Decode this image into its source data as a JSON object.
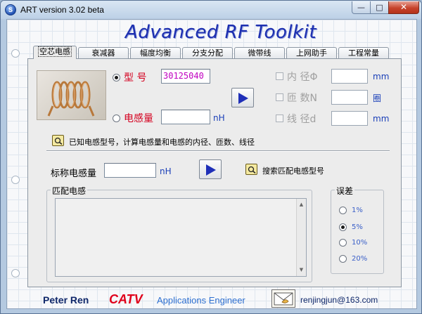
{
  "window": {
    "title": "ART version 3.02 beta",
    "app_icon_letter": "S",
    "minimize_glyph": "—",
    "maximize_glyph": "□",
    "close_glyph": "✕"
  },
  "banner": {
    "text": "Advanced RF Toolkit"
  },
  "tabs": [
    {
      "label": "空芯电感",
      "active": true
    },
    {
      "label": "衰减器",
      "active": false
    },
    {
      "label": "幅度均衡",
      "active": false
    },
    {
      "label": "分支分配",
      "active": false
    },
    {
      "label": "微带线",
      "active": false
    },
    {
      "label": "上网助手",
      "active": false
    },
    {
      "label": "工程常量",
      "active": false
    }
  ],
  "calc": {
    "model_label": "型  号",
    "model_value": "30125040",
    "inductance_label": "电感量",
    "inductance_unit": "nH",
    "inner_dia_label": "内  径Φ",
    "inner_dia_unit": "mm",
    "turns_label": "匝  数N",
    "turns_unit": "圈",
    "wire_dia_label": "线  径d",
    "wire_dia_unit": "mm",
    "hint": "已知电感型号，计算电感量和电感的内径、匝数、线径"
  },
  "match": {
    "nominal_label": "标称电感量",
    "nominal_unit": "nH",
    "search_hint": "搜索匹配电感型号",
    "group_title": "匹配电感"
  },
  "tolerance": {
    "title": "误差",
    "options": [
      {
        "label": "1%",
        "selected": false
      },
      {
        "label": "5%",
        "selected": true
      },
      {
        "label": "10%",
        "selected": false
      },
      {
        "label": "20%",
        "selected": false
      }
    ]
  },
  "footer": {
    "name": "Peter Ren",
    "company": "CATV",
    "role": "Applications Engineer",
    "email": "renjingjun@163.com"
  },
  "colors": {
    "banner": "#1d2fb0",
    "label_red": "#d4001f",
    "value_magenta": "#c000c0",
    "unit_blue": "#1a3fb8",
    "catv_red": "#e0001b"
  }
}
